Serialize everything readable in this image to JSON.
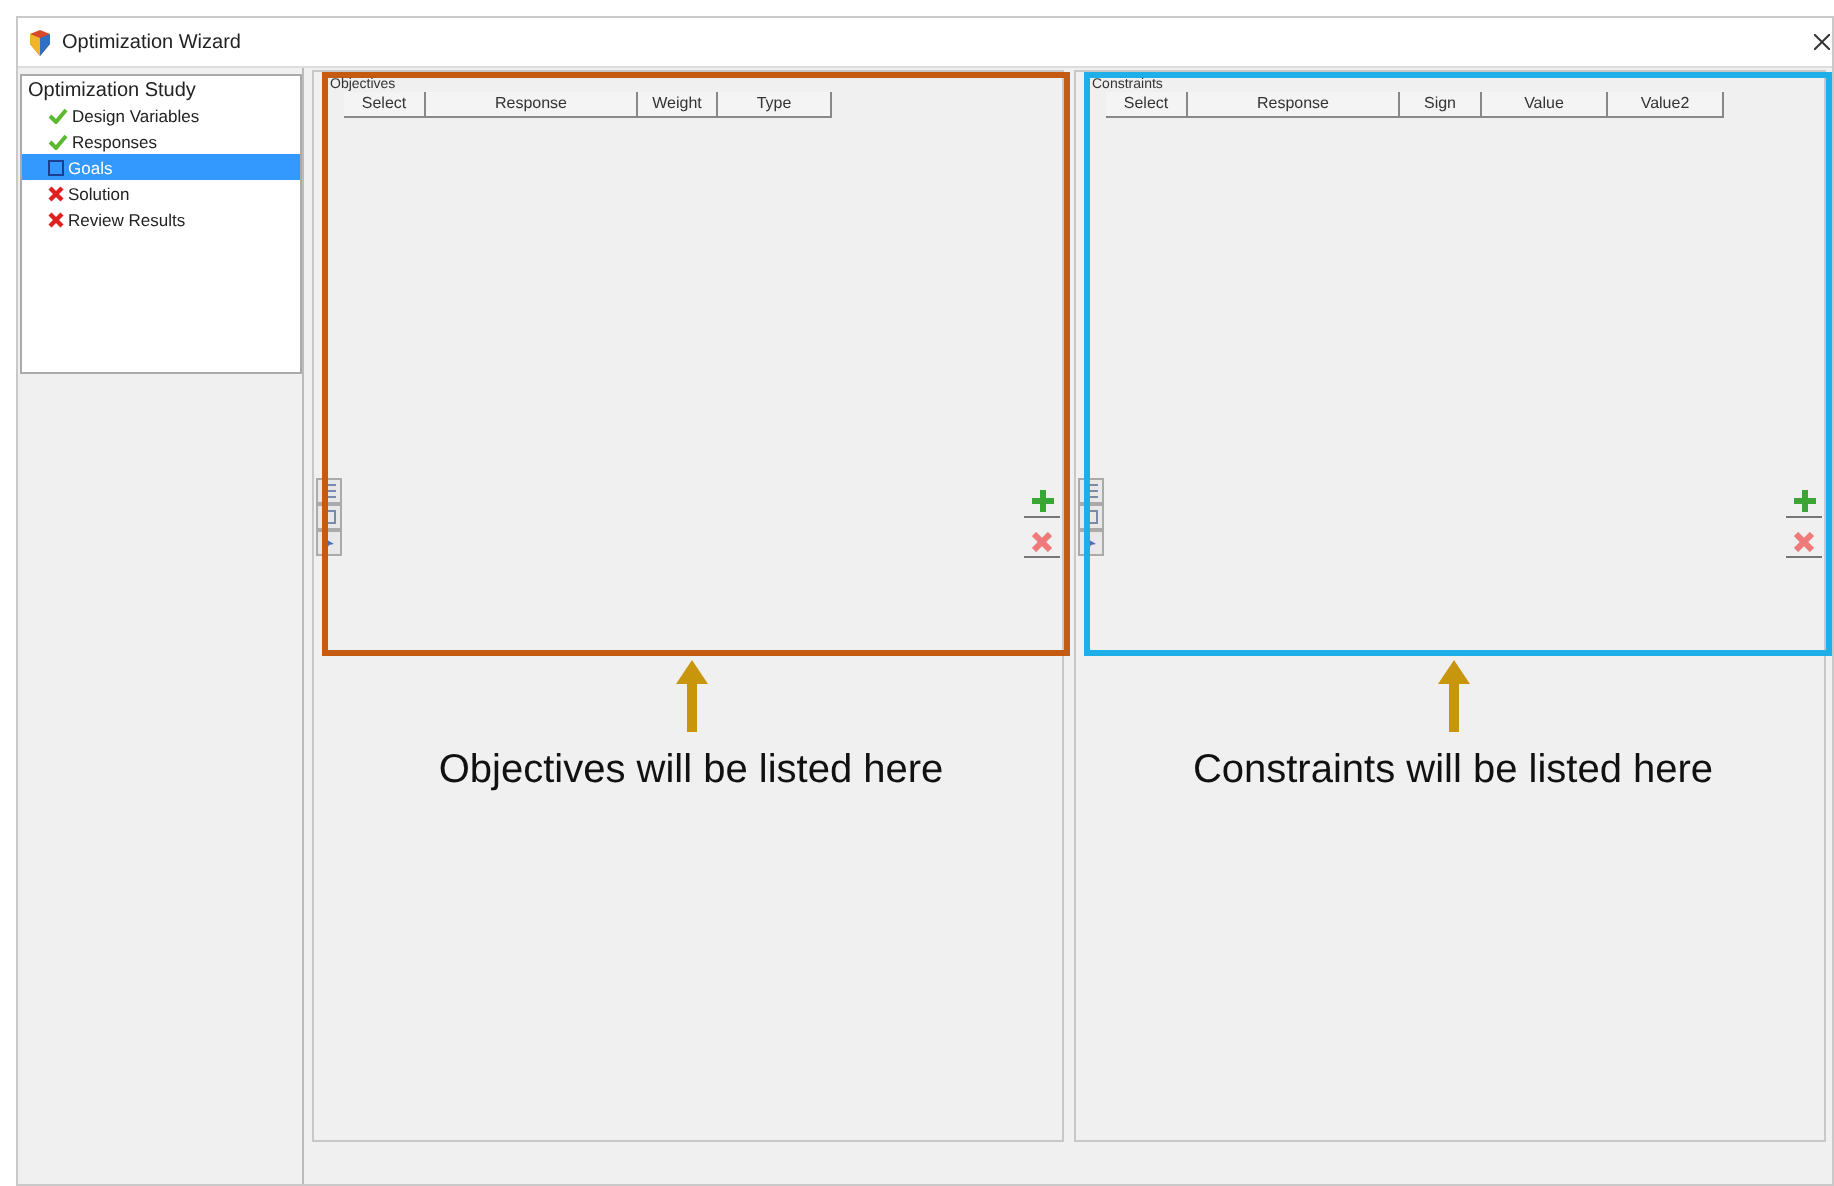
{
  "window": {
    "title": "Optimization Wizard"
  },
  "tree": {
    "root": "Optimization Study",
    "items": [
      {
        "label": "Design Variables",
        "kind": "done",
        "selected": false
      },
      {
        "label": "Responses",
        "kind": "done",
        "selected": false
      },
      {
        "label": "Goals",
        "kind": "current",
        "selected": true
      },
      {
        "label": "Solution",
        "kind": "error",
        "selected": false
      },
      {
        "label": "Review Results",
        "kind": "error",
        "selected": false
      }
    ]
  },
  "panels": [
    {
      "title": "Objectives",
      "color": "#c55a11",
      "columns": [
        "Select",
        "Response",
        "Weight",
        "Type"
      ],
      "annotation": "Objectives will be listed here"
    },
    {
      "title": "Constraints",
      "color": "#1eaee8",
      "columns": [
        "Select",
        "Response",
        "Sign",
        "Value",
        "Value2"
      ],
      "annotation": "Constraints will be listed here"
    }
  ]
}
